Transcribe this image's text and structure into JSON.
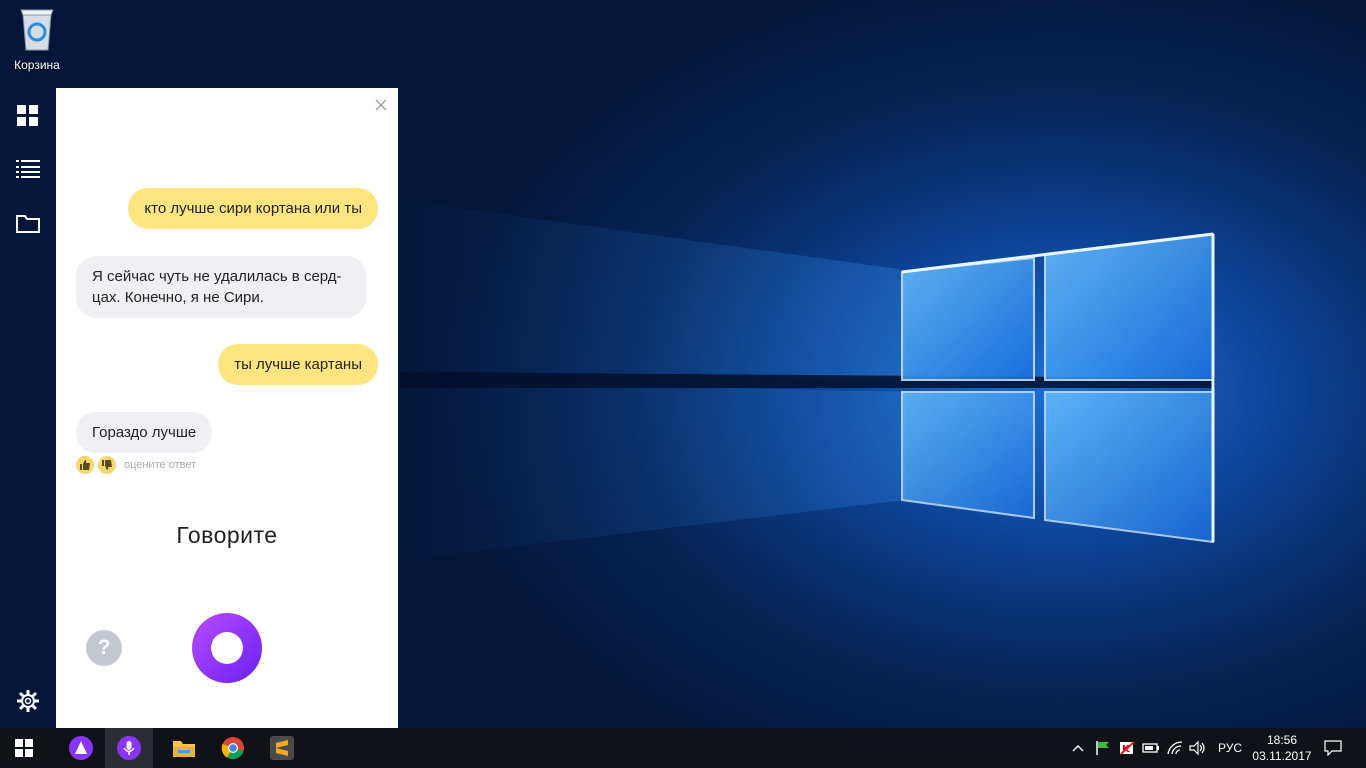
{
  "desktop": {
    "recycle_bin_label": "Корзина"
  },
  "app_strip": {
    "items": [
      {
        "icon": "grid-icon"
      },
      {
        "icon": "list-icon"
      },
      {
        "icon": "folder-icon"
      },
      {
        "icon": "settings-gear-icon"
      }
    ]
  },
  "alice": {
    "messages": [
      {
        "from": "user",
        "text": "кто лучше сири кортана или ты"
      },
      {
        "from": "assistant",
        "line1": "Я сейчас чуть не удалилась в серд-",
        "line2": "цах. Конечно, я не Сири."
      },
      {
        "from": "user",
        "text": "ты лучше картаны"
      },
      {
        "from": "assistant",
        "text": "Гораздо лучше"
      }
    ],
    "rating_hint": "оцените ответ",
    "speak_prompt": "Говорите",
    "help_label": "?"
  },
  "taskbar": {
    "apps": [
      {
        "name": "start",
        "icon": "windows-logo-icon"
      },
      {
        "name": "alice",
        "icon": "alice-icon"
      },
      {
        "name": "voice",
        "icon": "microphone-icon",
        "active": true
      },
      {
        "name": "explorer",
        "icon": "file-explorer-icon"
      },
      {
        "name": "chrome",
        "icon": "chrome-icon"
      },
      {
        "name": "sublime",
        "icon": "sublime-text-icon"
      }
    ],
    "language": "РУС",
    "time": "18:56",
    "date": "03.11.2017"
  },
  "colors": {
    "user_bubble": "#ffe57f",
    "assistant_bubble": "#f0f0f4",
    "accent_purple": "#8a34f8"
  }
}
